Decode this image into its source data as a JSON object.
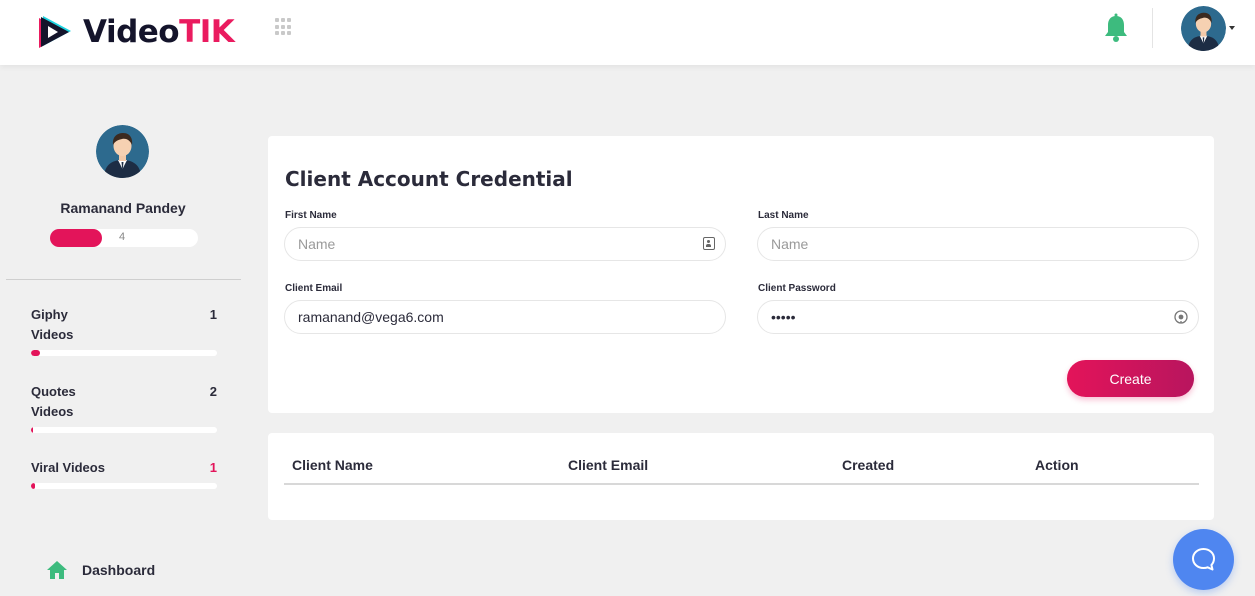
{
  "header": {
    "logo_part1": "Video",
    "logo_part2": "TIK",
    "icons": [
      "apps-grid-icon",
      "bell-icon",
      "avatar",
      "caret-down-icon"
    ],
    "colors": {
      "brand_dark": "#14142b",
      "brand_accent": "#ea1b5f",
      "bell": "#3dbb7e"
    }
  },
  "sidebar": {
    "user_name": "Ramanand Pandey",
    "credits_count": "4",
    "stats": [
      {
        "label": "Giphy Videos",
        "count": "1",
        "count_highlight": false,
        "progress": 0.05
      },
      {
        "label": "Quotes Videos",
        "count": "2",
        "count_highlight": false,
        "progress": 0.01
      },
      {
        "label": "Viral Videos",
        "count": "1",
        "count_highlight": true,
        "progress": 0.02
      }
    ],
    "nav": {
      "dashboard_label": "Dashboard"
    }
  },
  "form": {
    "title": "Client Account Credential",
    "first_name": {
      "label": "First Name",
      "placeholder": "Name",
      "value": ""
    },
    "last_name": {
      "label": "Last Name",
      "placeholder": "Name",
      "value": ""
    },
    "email": {
      "label": "Client Email",
      "value": "ramanand@vega6.com"
    },
    "password": {
      "label": "Client Password",
      "value": "•••••"
    },
    "create_label": "Create"
  },
  "table": {
    "columns": [
      "Client Name",
      "Client Email",
      "Created",
      "Action"
    ],
    "rows": []
  },
  "accent_color": "#e3145a",
  "chat_color": "#4f86f0"
}
